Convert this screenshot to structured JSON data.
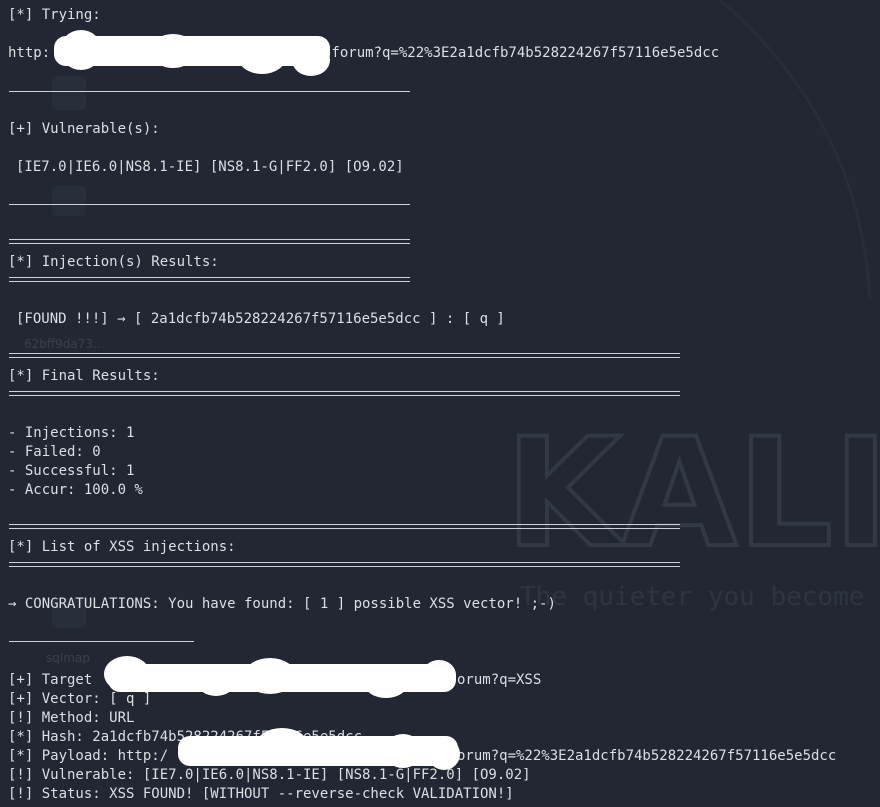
{
  "terminal": {
    "trying_header": "[*] Trying:",
    "trying_url_prefix": "http:",
    "trying_url_suffix": "/forum?q=%22%3E2a1dcfb74b528224267f57116e5e5dcc",
    "vulnerable_header": "[+] Vulnerable(s):",
    "vulnerable_list": "[IE7.0|IE6.0|NS8.1-IE] [NS8.1-G|FF2.0] [O9.02]",
    "injection_results_header": "[*] Injection(s) Results:",
    "found_line": "[FOUND !!!] → [ 2a1dcfb74b528224267f57116e5e5dcc ] : [ q ]",
    "final_results_header": "[*] Final Results:",
    "stats": [
      "- Injections: 1",
      "- Failed: 0",
      "- Successful: 1",
      "- Accur: 100.0 %"
    ],
    "xss_list_header": "[*] List of XSS injections:",
    "congrats_line": "→ CONGRATULATIONS: You have found: [ 1 ] possible XSS vector! ;-)",
    "target_prefix": "[+] Target",
    "target_suffix": "orum?q=XSS",
    "vector_line": "[+] Vector: [ q ]",
    "method_line": "[!] Method: URL",
    "hash_line": "[*] Hash: 2a1dcfb74b528224267f57116e5e5dcc",
    "payload_prefix": "[*] Payload: http:/",
    "payload_suffix": "orum?q=%22%3E2a1dcfb74b528224267f57116e5e5dcc",
    "vulnerable_line": "[!] Vulnerable: [IE7.0|IE6.0|NS8.1-IE] [NS8.1-G|FF2.0] [O9.02]",
    "status_line": "[!] Status: XSS FOUND! [WITHOUT --reverse-check VALIDATION!]"
  },
  "wallpaper": {
    "logo_text": "KALI",
    "tagline": "The quieter you become",
    "desktop_icon_labels": [
      "62bff9da73...",
      "sqlmap"
    ]
  },
  "colors": {
    "background": "#232733",
    "text": "#dcdfe4",
    "redaction": "#ffffff"
  }
}
